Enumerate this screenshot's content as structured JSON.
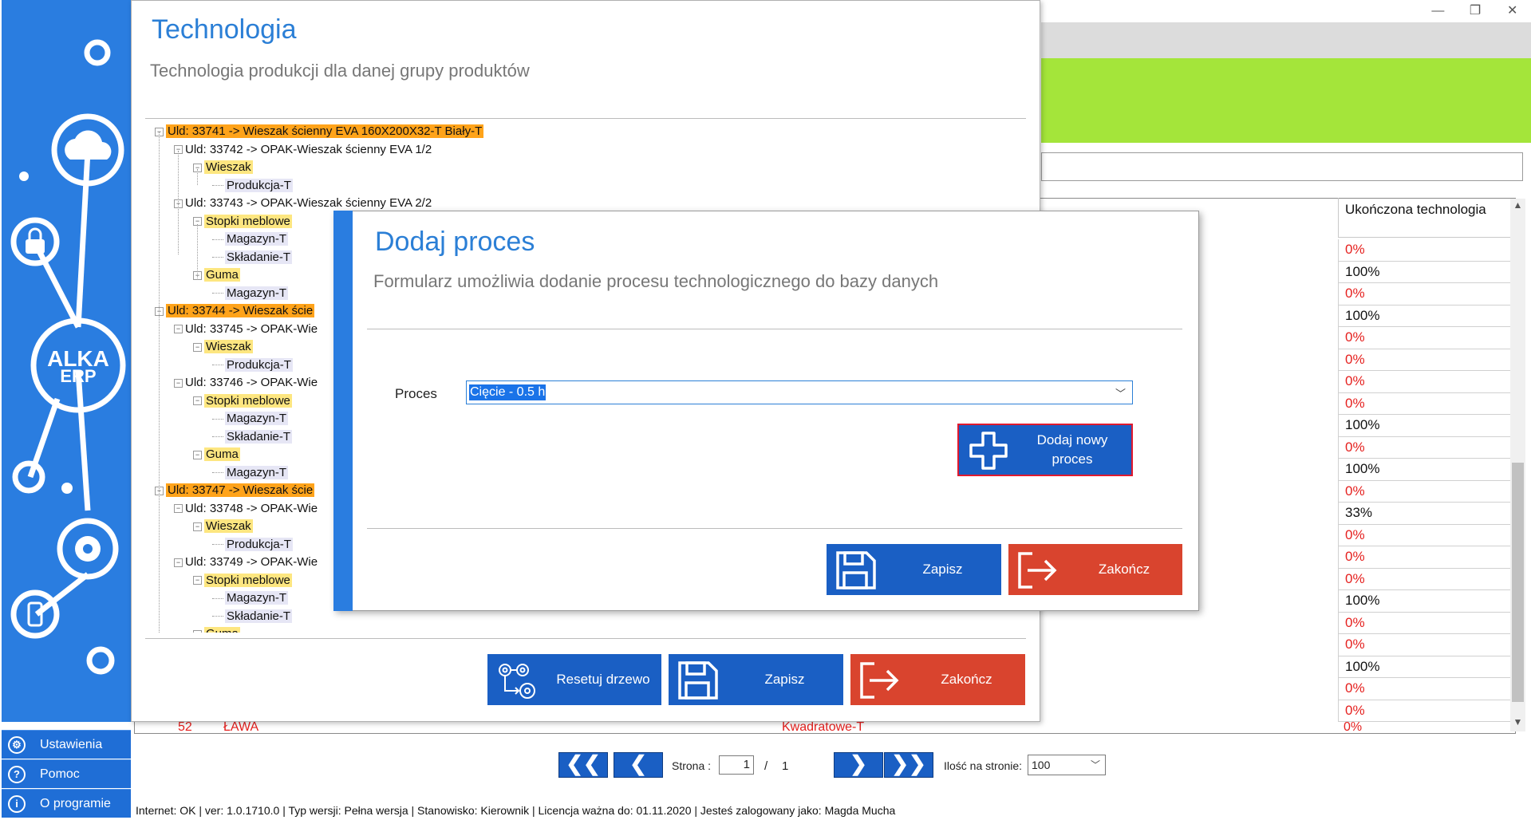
{
  "window_controls": {
    "minimize": "—",
    "restore": "❐",
    "close": "✕"
  },
  "sidebar": {
    "logo_text_1": "ALKA",
    "logo_text_2": "ERP",
    "items": [
      {
        "label": "Ustawienia",
        "icon": "gear-icon",
        "glyph": "⚙"
      },
      {
        "label": "Pomoc",
        "icon": "help-icon",
        "glyph": "?"
      },
      {
        "label": "O programie",
        "icon": "info-icon",
        "glyph": "i"
      }
    ]
  },
  "grid": {
    "column_header": "Ukończona technologia",
    "rows": [
      "0%",
      "100%",
      "0%",
      "100%",
      "0%",
      "0%",
      "0%",
      "0%",
      "100%",
      "0%",
      "100%",
      "0%",
      "33%",
      "0%",
      "0%",
      "0%",
      "100%",
      "0%",
      "0%",
      "100%",
      "0%",
      "0%"
    ],
    "cut_row": {
      "num": "52",
      "name": "ŁAWA",
      "tech": "Kwadratowe-T",
      "pct": "0%"
    }
  },
  "pagination": {
    "first": "❮❮",
    "prev": "❮",
    "next": "❯",
    "last": "❯❯",
    "page_label": "Strona :",
    "page_value": "1",
    "separator": "/",
    "total_pages": "1",
    "per_page_label": "Ilość na stronie:",
    "per_page_value": "100"
  },
  "status_bar": "Internet: OK  |  ver: 1.0.1710.0  |  Typ wersji: Pełna wersja  |  Stanowisko: Kierownik  |  Licencja ważna do: 01.11.2020  |  Jesteś zalogowany jako: Magda Mucha",
  "technologia": {
    "title": "Technologia",
    "subtitle": "Technologia produkcji dla danej grupy produktów",
    "tree": [
      {
        "text": "Uld: 33741 -> Wieszak ścienny EVA 160X200X32-T Biały-T",
        "style": "orange",
        "level": 0
      },
      {
        "text": "Uld: 33742 -> OPAK-Wieszak ścienny EVA   1/2",
        "style": "none",
        "level": 1
      },
      {
        "text": "Wieszak",
        "style": "yellow",
        "level": 2
      },
      {
        "text": "Produkcja-T",
        "style": "lav",
        "level": 3
      },
      {
        "text": "Uld: 33743 -> OPAK-Wieszak ścienny EVA   2/2",
        "style": "none",
        "level": 1
      },
      {
        "text": "Stopki meblowe",
        "style": "yellow",
        "level": 2
      },
      {
        "text": "Magazyn-T",
        "style": "lav",
        "level": 3
      },
      {
        "text": "Składanie-T",
        "style": "lav",
        "level": 3
      },
      {
        "text": "Guma",
        "style": "yellow",
        "level": 2
      },
      {
        "text": "Magazyn-T",
        "style": "lav",
        "level": 3
      },
      {
        "text": "Uld: 33744 -> Wieszak ście",
        "style": "orange",
        "level": 0
      },
      {
        "text": "Uld: 33745 -> OPAK-Wie",
        "style": "none",
        "level": 1
      },
      {
        "text": "Wieszak",
        "style": "yellow",
        "level": 2
      },
      {
        "text": "Produkcja-T",
        "style": "lav",
        "level": 3
      },
      {
        "text": "Uld: 33746 -> OPAK-Wie",
        "style": "none",
        "level": 1
      },
      {
        "text": "Stopki meblowe",
        "style": "yellow",
        "level": 2
      },
      {
        "text": "Magazyn-T",
        "style": "lav",
        "level": 3
      },
      {
        "text": "Składanie-T",
        "style": "lav",
        "level": 3
      },
      {
        "text": "Guma",
        "style": "yellow",
        "level": 2
      },
      {
        "text": "Magazyn-T",
        "style": "lav",
        "level": 3
      },
      {
        "text": "Uld: 33747 -> Wieszak ście",
        "style": "orange",
        "level": 0
      },
      {
        "text": "Uld: 33748 -> OPAK-Wie",
        "style": "none",
        "level": 1
      },
      {
        "text": "Wieszak",
        "style": "yellow",
        "level": 2
      },
      {
        "text": "Produkcja-T",
        "style": "lav",
        "level": 3
      },
      {
        "text": "Uld: 33749 -> OPAK-Wie",
        "style": "none",
        "level": 1
      },
      {
        "text": "Stopki meblowe",
        "style": "yellow",
        "level": 2
      },
      {
        "text": "Magazyn-T",
        "style": "lav",
        "level": 3
      },
      {
        "text": "Składanie-T",
        "style": "lav",
        "level": 3
      },
      {
        "text": "Guma",
        "style": "yellow",
        "level": 2
      }
    ],
    "buttons": {
      "reset": "Resetuj drzewo",
      "save": "Zapisz",
      "close": "Zakończ"
    }
  },
  "dialog": {
    "title": "Dodaj proces",
    "subtitle": "Formularz umożliwia dodanie procesu technologicznego do bazy danych",
    "process_label": "Proces",
    "process_value": "Cięcie - 0.5 h",
    "add_new_label": "Dodaj nowy proces",
    "save": "Zapisz",
    "close": "Zakończ"
  },
  "colors": {
    "accent_blue": "#2a7de0",
    "button_blue": "#1a5fc4",
    "button_red": "#d9442e",
    "green_band": "#a4e53a",
    "tree_orange": "#ffa31a",
    "tree_yellow": "#fde680",
    "percent_red": "#e5201e"
  }
}
